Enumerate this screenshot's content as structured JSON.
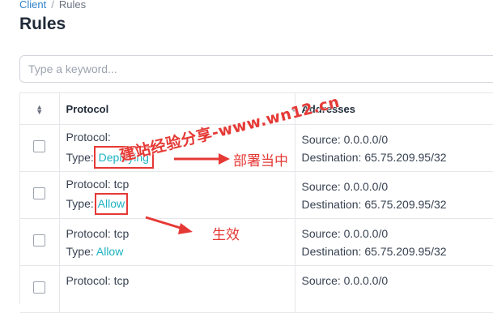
{
  "breadcrumb": {
    "parent": "Client",
    "separator": "/",
    "current": "Rules"
  },
  "page_title": "Rules",
  "search": {
    "placeholder": "Type a keyword...",
    "value": ""
  },
  "table": {
    "columns": [
      "Protocol",
      "Addresses"
    ],
    "rows": [
      {
        "protocol_label": "Protocol:",
        "type_prefix": "Type:",
        "type_value": "Deploying",
        "source": "Source: 0.0.0.0/0",
        "destination": "Destination: 65.75.209.95/32"
      },
      {
        "protocol_label": "Protocol: tcp",
        "type_prefix": "Type:",
        "type_value": "Allow",
        "source": "Source: 0.0.0.0/0",
        "destination": "Destination: 65.75.209.95/32"
      },
      {
        "protocol_label": "Protocol: tcp",
        "type_prefix": "Type:",
        "type_value": "Allow",
        "source": "Source: 0.0.0.0/0",
        "destination": "Destination: 65.75.209.95/32"
      },
      {
        "protocol_label": "Protocol: tcp",
        "type_prefix": "",
        "type_value": "",
        "source": "Source: 0.0.0.0/0",
        "destination": ""
      }
    ]
  },
  "annotations": {
    "deploying_note": "部署当中",
    "allow_note": "生效",
    "watermark": "建站经验分享-www.wn12.cn"
  },
  "colors": {
    "link": "#2f80c9",
    "status": "#1bb3c2",
    "annotation": "#e53935"
  },
  "icons": [
    "sort-icon",
    "column-sort-icon",
    "arrow-annotation-icon"
  ]
}
